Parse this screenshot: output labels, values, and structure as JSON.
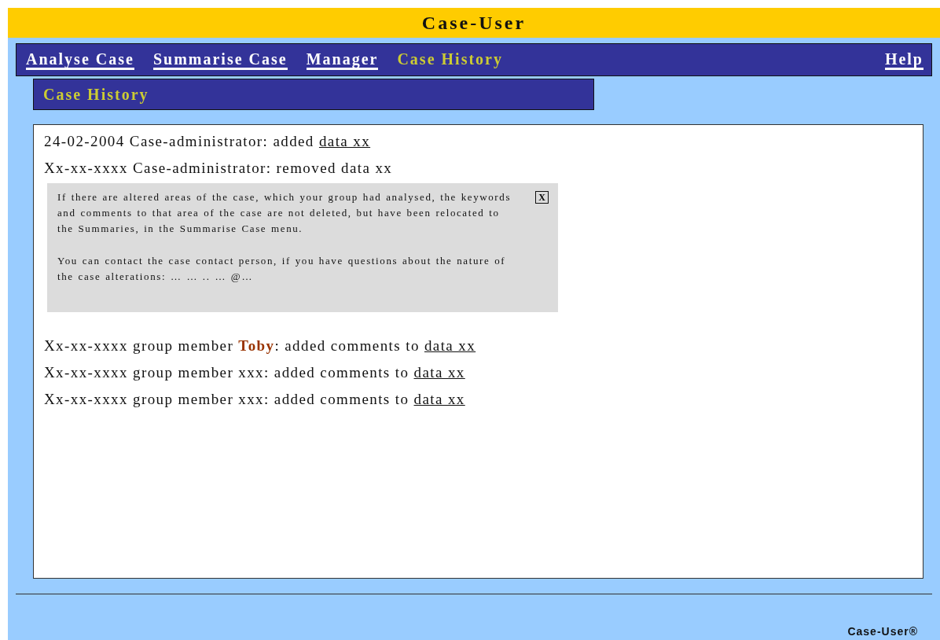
{
  "header": {
    "title": "Case-User"
  },
  "nav": {
    "items": [
      {
        "label": "Analyse Case",
        "selected": false
      },
      {
        "label": "Summarise Case",
        "selected": false
      },
      {
        "label": "Manager",
        "selected": false
      },
      {
        "label": "Case History",
        "selected": true
      }
    ],
    "help": "Help"
  },
  "section_title": "Case History",
  "entries": [
    {
      "kind": "entry",
      "text": "24-02-2004 Case-administrator: added ",
      "link": "data xx"
    },
    {
      "kind": "entry",
      "text": "Xx-xx-xxxx Case-administrator: removed data xx"
    },
    {
      "kind": "note",
      "paragraphs": [
        "If there are altered areas of the case, which your group had analysed, the keywords and comments to that area of the case are not deleted, but have been relocated to the Summaries, in the Summarise Case menu.",
        "You can contact the case contact person, if you have questions about the nature of the case alterations: … … .. … @…"
      ],
      "close": "X"
    },
    {
      "kind": "entry",
      "text": "Xx-xx-xxxx group member **Toby**: added comments to ",
      "link": "data xx"
    },
    {
      "kind": "entry",
      "text": "Xx-xx-xxxx group member xxx: added comments to ",
      "link": "data xx"
    },
    {
      "kind": "entry",
      "text": "Xx-xx-xxxx group member xxx: added comments to ",
      "link": "data xx"
    }
  ],
  "footer": {
    "text": "Case-User®"
  }
}
